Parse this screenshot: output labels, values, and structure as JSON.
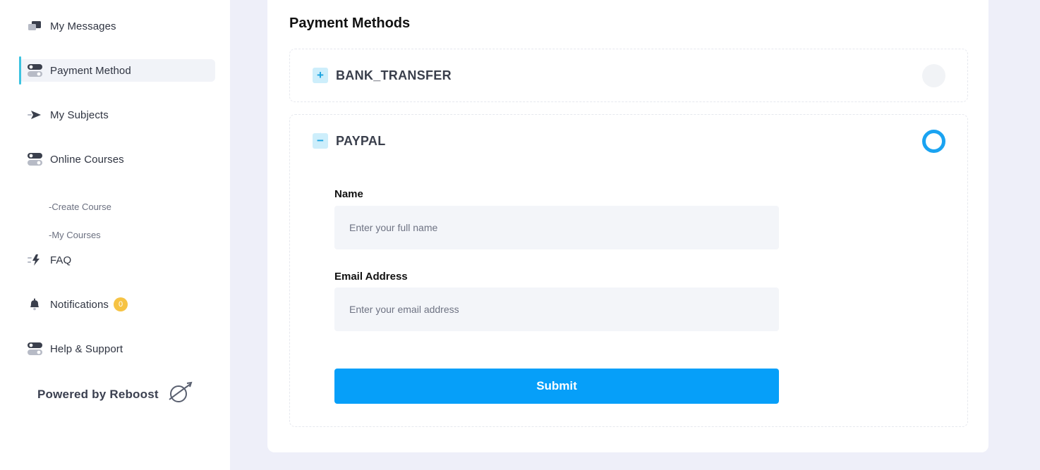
{
  "sidebar": {
    "items": [
      {
        "label": "My Messages",
        "icon": "messages-icon"
      },
      {
        "label": "Payment Method",
        "icon": "toggle-icon",
        "active": true
      },
      {
        "label": "My Subjects",
        "icon": "send-icon"
      },
      {
        "label": "Online Courses",
        "icon": "toggle-icon"
      },
      {
        "label": "FAQ",
        "icon": "lightning-icon"
      },
      {
        "label": "Notifications",
        "icon": "bell-icon",
        "badge": "0"
      },
      {
        "label": "Help & Support",
        "icon": "toggle-icon"
      }
    ],
    "sub_items": [
      "-Create Course",
      "-My Courses"
    ],
    "powered_by": "Powered by Reboost"
  },
  "main": {
    "title": "Payment Methods",
    "methods": [
      {
        "name": "BANK_TRANSFER",
        "toggle": "+",
        "selected": false,
        "expanded": false
      },
      {
        "name": "PAYPAL",
        "toggle": "−",
        "selected": true,
        "expanded": true
      }
    ],
    "form": {
      "name_label": "Name",
      "name_placeholder": "Enter your full name",
      "email_label": "Email Address",
      "email_placeholder": "Enter your email address",
      "submit_label": "Submit"
    }
  },
  "colors": {
    "accent": "#069ff9",
    "active_indicator": "#3cc3e0",
    "badge": "#f6c344",
    "background": "#eeeff9"
  }
}
